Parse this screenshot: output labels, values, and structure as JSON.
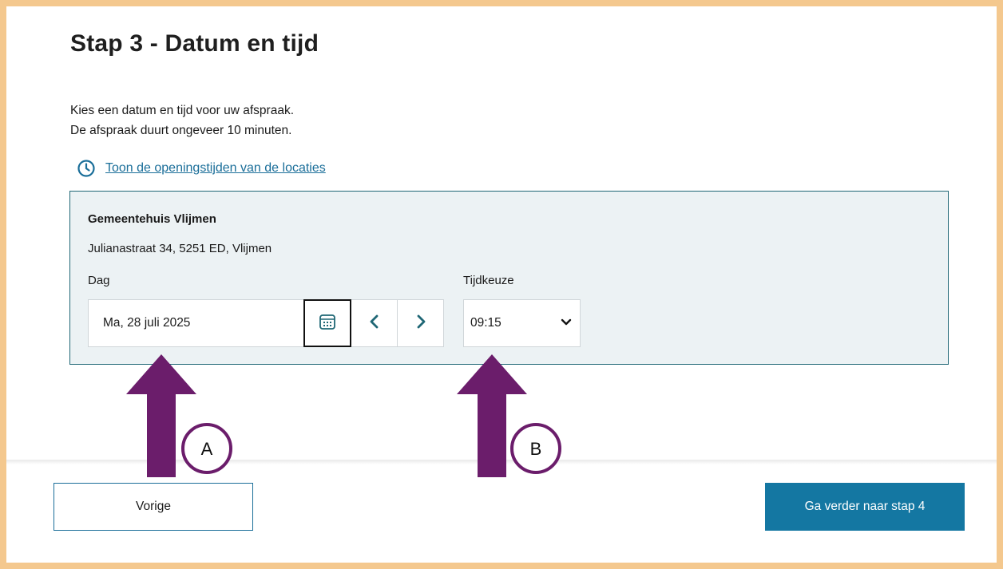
{
  "page": {
    "title": "Stap 3 - Datum en tijd",
    "intro_line1": "Kies een datum en tijd voor uw afspraak.",
    "intro_line2": "De afspraak duurt ongeveer 10 minuten.",
    "hours_link": "Toon de openingstijden van de locaties"
  },
  "location": {
    "name": "Gemeentehuis Vlijmen",
    "address": "Julianastraat 34, 5251 ED, Vlijmen"
  },
  "date_field": {
    "label": "Dag",
    "value": "Ma, 28 juli 2025",
    "calendar_icon": "calendar-icon",
    "prev_icon": "chevron-left-icon",
    "next_icon": "chevron-right-icon"
  },
  "time_field": {
    "label": "Tijdkeuze",
    "value": "09:15",
    "dropdown_icon": "chevron-down-icon"
  },
  "footer": {
    "prev_label": "Vorige",
    "next_label": "Ga verder naar stap 4"
  },
  "annotations": {
    "marker_a": "A",
    "marker_b": "B",
    "arrow_color": "#6b1d6b"
  },
  "colors": {
    "frame": "#f4c88e",
    "accent": "#1477a2",
    "panel": "#ecf2f4"
  }
}
